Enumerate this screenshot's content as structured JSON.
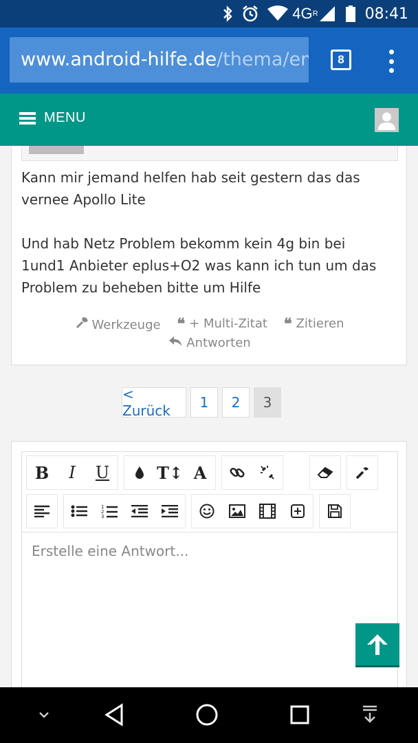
{
  "status": {
    "network": "4G",
    "network_sup": "R",
    "time": "08:41"
  },
  "browser": {
    "url_host": "www.android-hilfe.de",
    "url_path": "/thema/emp",
    "tab_count": "8"
  },
  "site_header": {
    "menu_label": "MENU"
  },
  "post": {
    "paragraphs": [
      "Kann mir jemand helfen hab seit gestern das das vernee Apollo Lite",
      "Und hab Netz Problem bekomm kein 4g bin bei 1und1 Anbieter eplus+O2 was kann ich tun um das Problem zu beheben bitte um Hilfe"
    ],
    "actions": {
      "tools": "Werkzeuge",
      "multi_quote": "+ Multi-Zitat",
      "quote": "Zitieren",
      "reply": "Antworten"
    }
  },
  "pagination": {
    "back": "< Zurück",
    "pages": [
      "1",
      "2",
      "3"
    ],
    "current": "3"
  },
  "editor": {
    "placeholder": "Erstelle eine Antwort...",
    "toolbar_row1": [
      "bold",
      "italic",
      "underline",
      "color",
      "font-size",
      "font",
      "link",
      "unlink",
      "eraser",
      "wrench"
    ],
    "toolbar_row2": [
      "align-left",
      "bullet-list",
      "numbered-list",
      "outdent",
      "indent",
      "smiley",
      "image",
      "media",
      "insert",
      "save"
    ]
  },
  "colors": {
    "status_bar": "#0a3f7a",
    "browser_bar": "#1565c0",
    "site_header": "#009688",
    "link": "#1e6bb8"
  }
}
